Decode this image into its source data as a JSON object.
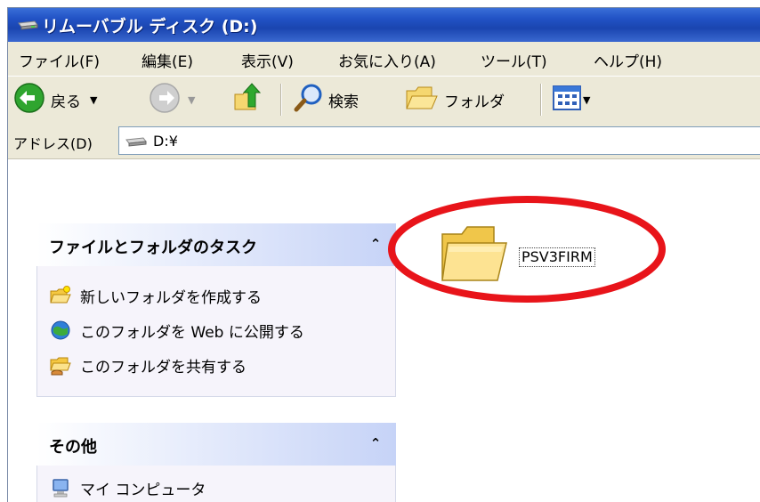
{
  "window": {
    "title": "リムーバブル ディスク (D:)"
  },
  "menu": {
    "items": [
      "ファイル(F)",
      "編集(E)",
      "表示(V)",
      "お気に入り(A)",
      "ツール(T)",
      "ヘルプ(H)"
    ]
  },
  "toolbar": {
    "back_label": "戻る",
    "search_label": "検索",
    "folders_label": "フォルダ"
  },
  "address": {
    "label": "アドレス(D)",
    "value": "D:¥"
  },
  "tasks_panel": {
    "title": "ファイルとフォルダのタスク",
    "collapse_glyph": "⌃",
    "items": [
      {
        "label": "新しいフォルダを作成する",
        "icon": "new-folder-icon"
      },
      {
        "label": "このフォルダを Web に公開する",
        "icon": "web-publish-icon"
      },
      {
        "label": "このフォルダを共有する",
        "icon": "share-folder-icon"
      }
    ]
  },
  "other_panel": {
    "title": "その他",
    "collapse_glyph": "⌃",
    "items": [
      {
        "label": "マイ コンピュータ",
        "icon": "my-computer-icon"
      }
    ]
  },
  "files": [
    {
      "name": "PSV3FIRM",
      "type": "folder"
    }
  ],
  "colors": {
    "title_bar": "#2253c6",
    "chrome": "#ece9d8",
    "highlight_ring": "#e8141a",
    "panel_bg": "#f6f4fb"
  }
}
